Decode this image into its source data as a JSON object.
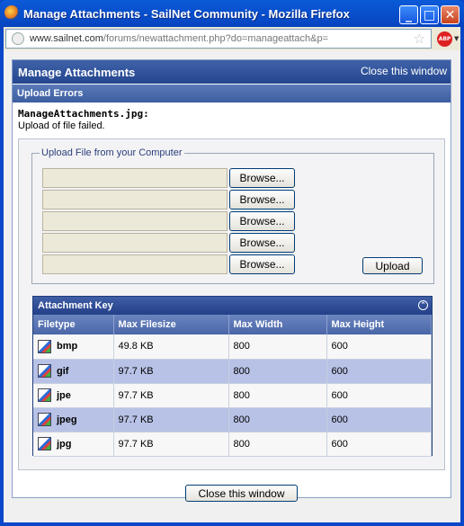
{
  "window": {
    "title": "Manage Attachments - SailNet Community - Mozilla Firefox",
    "minimize_glyph": "_",
    "maximize_glyph": "□",
    "close_glyph": "✕"
  },
  "address": {
    "domain": "www.sailnet.com",
    "path": "/forums/newattachment.php?do=manageattach&p=",
    "star_glyph": "☆",
    "abp_label": "ABP",
    "abp_arrow": "▼"
  },
  "page": {
    "title": "Manage Attachments",
    "close_top": "Close this window",
    "errors_header": "Upload Errors",
    "error_file": "ManageAttachments.jpg:",
    "error_message": "Upload of file failed.",
    "upload_legend": "Upload File from your Computer",
    "browse_label": "Browse...",
    "upload_label": "Upload",
    "close_bottom": "Close this window"
  },
  "attachment_key": {
    "title": "Attachment Key",
    "collapse_glyph": "⌃",
    "columns": [
      "Filetype",
      "Max Filesize",
      "Max Width",
      "Max Height"
    ],
    "rows": [
      [
        "bmp",
        "49.8 KB",
        "800",
        "600"
      ],
      [
        "gif",
        "97.7 KB",
        "800",
        "600"
      ],
      [
        "jpe",
        "97.7 KB",
        "800",
        "600"
      ],
      [
        "jpeg",
        "97.7 KB",
        "800",
        "600"
      ],
      [
        "jpg",
        "97.7 KB",
        "800",
        "600"
      ]
    ]
  }
}
